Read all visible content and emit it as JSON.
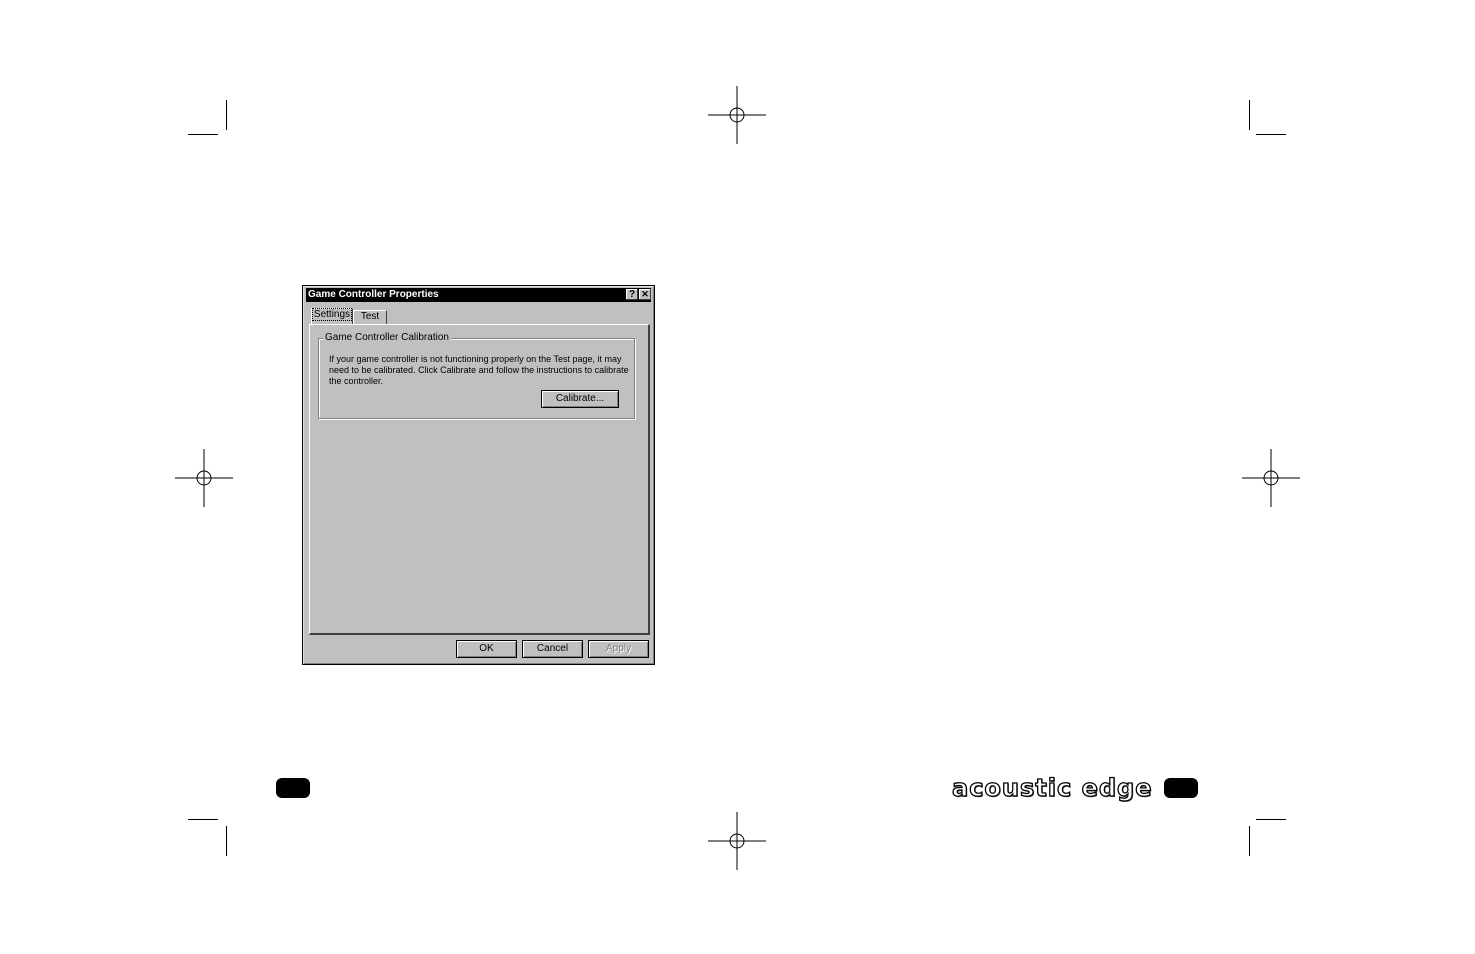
{
  "dialog": {
    "title": "Game Controller Properties",
    "help_button": "?",
    "close_button": "✕",
    "tabs": [
      {
        "label": "Settings"
      },
      {
        "label": "Test"
      }
    ],
    "group": {
      "title": "Game Controller Calibration",
      "text_lines": [
        "If your game controller is not functioning properly on the Test page, it may",
        "need to be calibrated.  Click Calibrate and follow the instructions to calibrate",
        "the controller."
      ],
      "calibrate_label": "Calibrate..."
    },
    "buttons": {
      "ok_label": "OK",
      "cancel_label": "Cancel",
      "apply_label": "Apply"
    }
  },
  "brand": {
    "text": "acoustic edge"
  }
}
